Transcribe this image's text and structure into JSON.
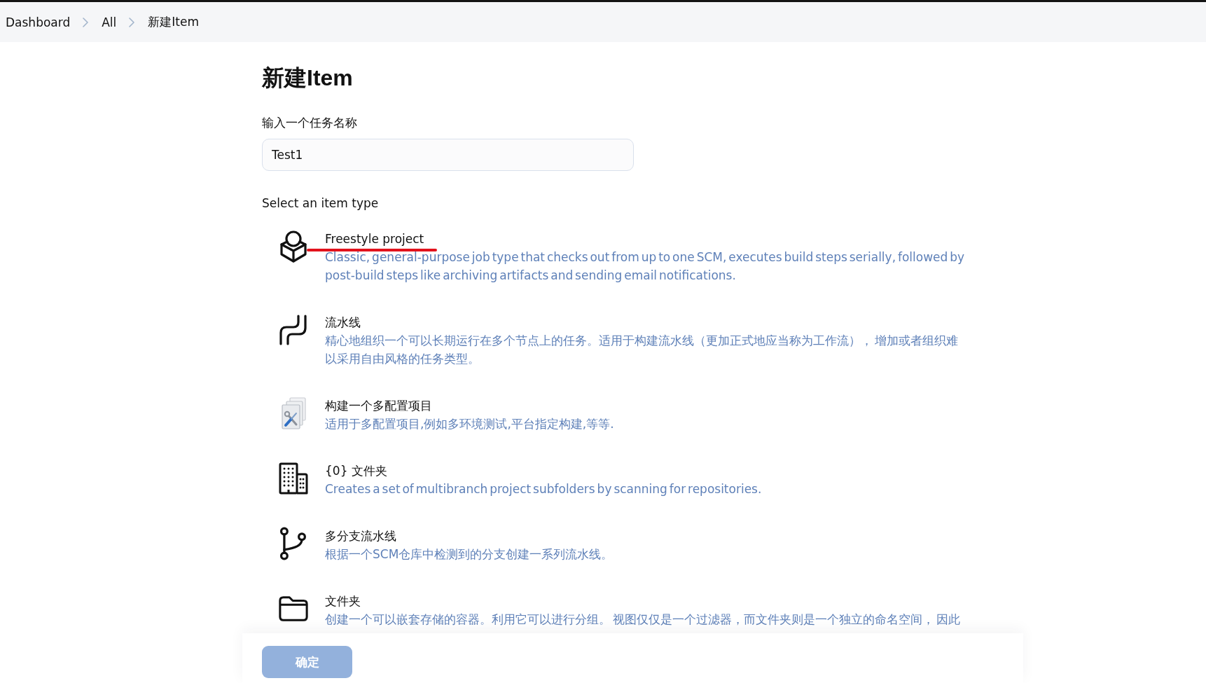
{
  "breadcrumb": [
    "Dashboard",
    "All",
    "新建Item"
  ],
  "page": {
    "title": "新建Item"
  },
  "name_field": {
    "label": "输入一个任务名称",
    "value": "Test1"
  },
  "item_types": {
    "heading": "Select an item type",
    "items": [
      {
        "kind": "freestyle",
        "title": "Freestyle project",
        "description": "Classic, general-purpose job type that checks out from up to one SCM, executes build steps serially, followed by post-build steps like archiving artifacts and sending email notifications.",
        "underlined": true
      },
      {
        "kind": "pipeline",
        "title": "流水线",
        "description": "精心地组织一个可以长期运行在多个节点上的任务。适用于构建流水线（更加正式地应当称为工作流）， 增加或者组织难以采用自由风格的任务类型。",
        "underlined": false
      },
      {
        "kind": "matrix",
        "title": "构建一个多配置项目",
        "description": "适用于多配置项目,例如多环境测试,平台指定构建,等等.",
        "underlined": false
      },
      {
        "kind": "organization",
        "title": "{0} 文件夹",
        "description": "Creates a set of multibranch project subfolders by scanning for repositories.",
        "underlined": false
      },
      {
        "kind": "multibranch",
        "title": "多分支流水线",
        "description": "根据一个SCM仓库中检测到的分支创建一系列流水线。",
        "underlined": false
      },
      {
        "kind": "folder",
        "title": "文件夹",
        "description": "创建一个可以嵌套存储的容器。利用它可以进行分组。 视图仅仅是一个过滤器，而文件夹则是一个独立的命名空间， 因此",
        "underlined": false
      }
    ]
  },
  "footer": {
    "ok_button": {
      "label": "确定",
      "disabled": true
    }
  }
}
